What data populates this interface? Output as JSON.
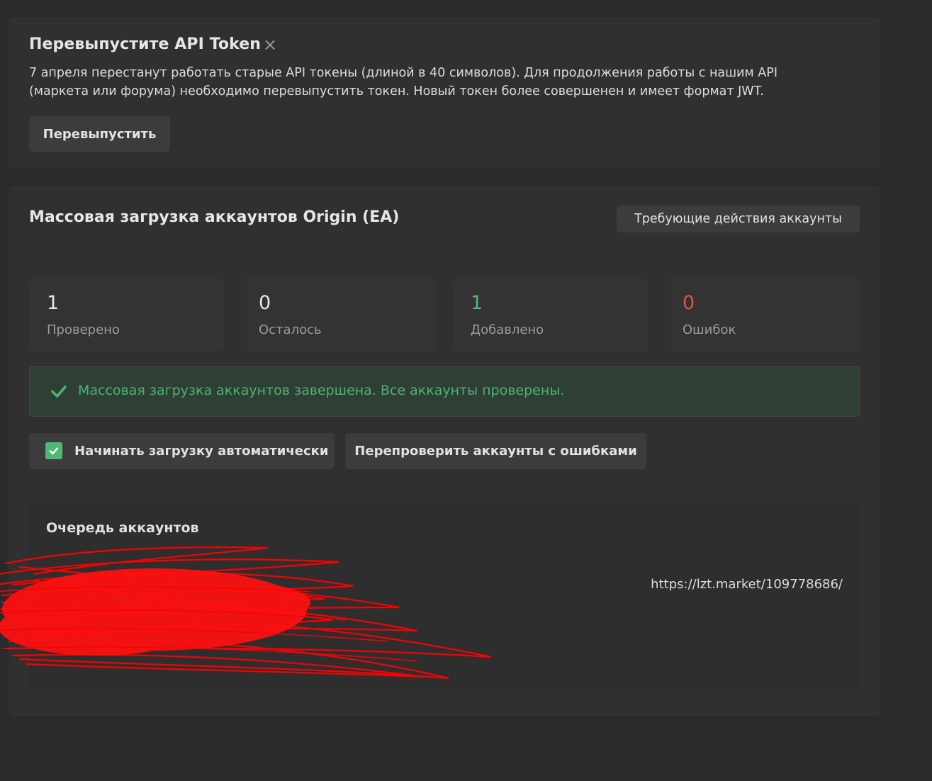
{
  "notice": {
    "title": "Перевыпустите API Token",
    "close_icon": "×",
    "text": "7 апреля перестанут работать старые API токены (длиной в 40 символов). Для продолжения работы с нашим API (маркета или форума) необходимо перевыпустить токен. Новый токен более совершенен и имеет формат JWT.",
    "button_label": "Перевыпустить"
  },
  "upload": {
    "title": "Массовая загрузка аккаунтов Origin (EA)",
    "needs_action_label": "Требующие действия аккаунты",
    "stats": [
      {
        "value": "1",
        "label": "Проверено"
      },
      {
        "value": "0",
        "label": "Осталось"
      },
      {
        "value": "1",
        "label": "Добавлено"
      },
      {
        "value": "0",
        "label": "Ошибок"
      }
    ],
    "success_message": "Массовая загрузка аккаунтов завершена. Все аккаунты проверены.",
    "auto_start_label": "Начинать загрузку автоматически",
    "auto_start_checked": true,
    "recheck_label": "Перепроверить аккаунты с ошибками",
    "queue": {
      "title": "Очередь аккаунтов",
      "link": "https://lzt.market/109778686/"
    }
  },
  "colors": {
    "success": "#49b471",
    "error": "#d9534f",
    "redaction": "#ff0000"
  }
}
